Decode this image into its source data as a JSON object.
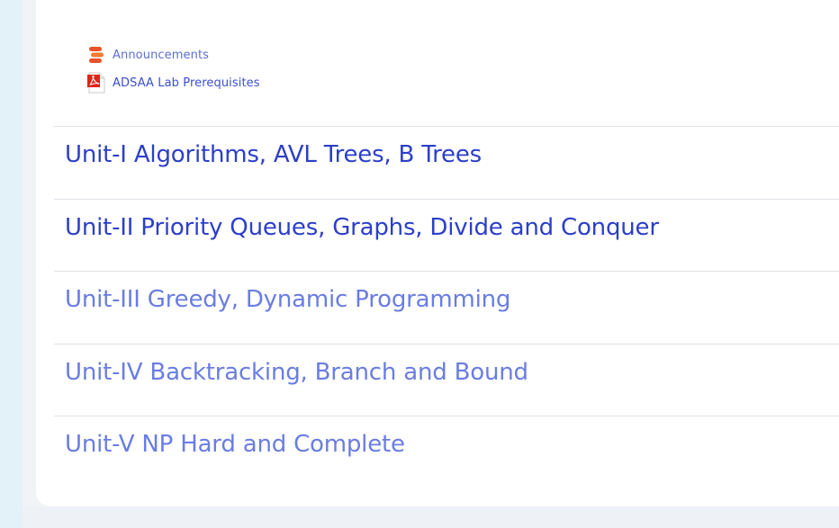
{
  "activities": [
    {
      "name": "Announcements",
      "icon": "forum-icon"
    },
    {
      "name": "ADSAA Lab Prerequisites",
      "icon": "pdf-icon"
    }
  ],
  "sections": [
    {
      "title": "Unit-I Algorithms, AVL Trees, B Trees"
    },
    {
      "title": "Unit-II Priority Queues, Graphs, Divide and Conquer"
    },
    {
      "title": "Unit-III Greedy, Dynamic Programming"
    },
    {
      "title": "Unit-IV Backtracking, Branch and Bound"
    },
    {
      "title": "Unit-V NP Hard and Complete"
    }
  ],
  "colors": {
    "link": "#2c3fc9",
    "link_light": "#6a7de2",
    "pdf_red": "#e2231a",
    "forum_orange": "#f26b2d"
  }
}
